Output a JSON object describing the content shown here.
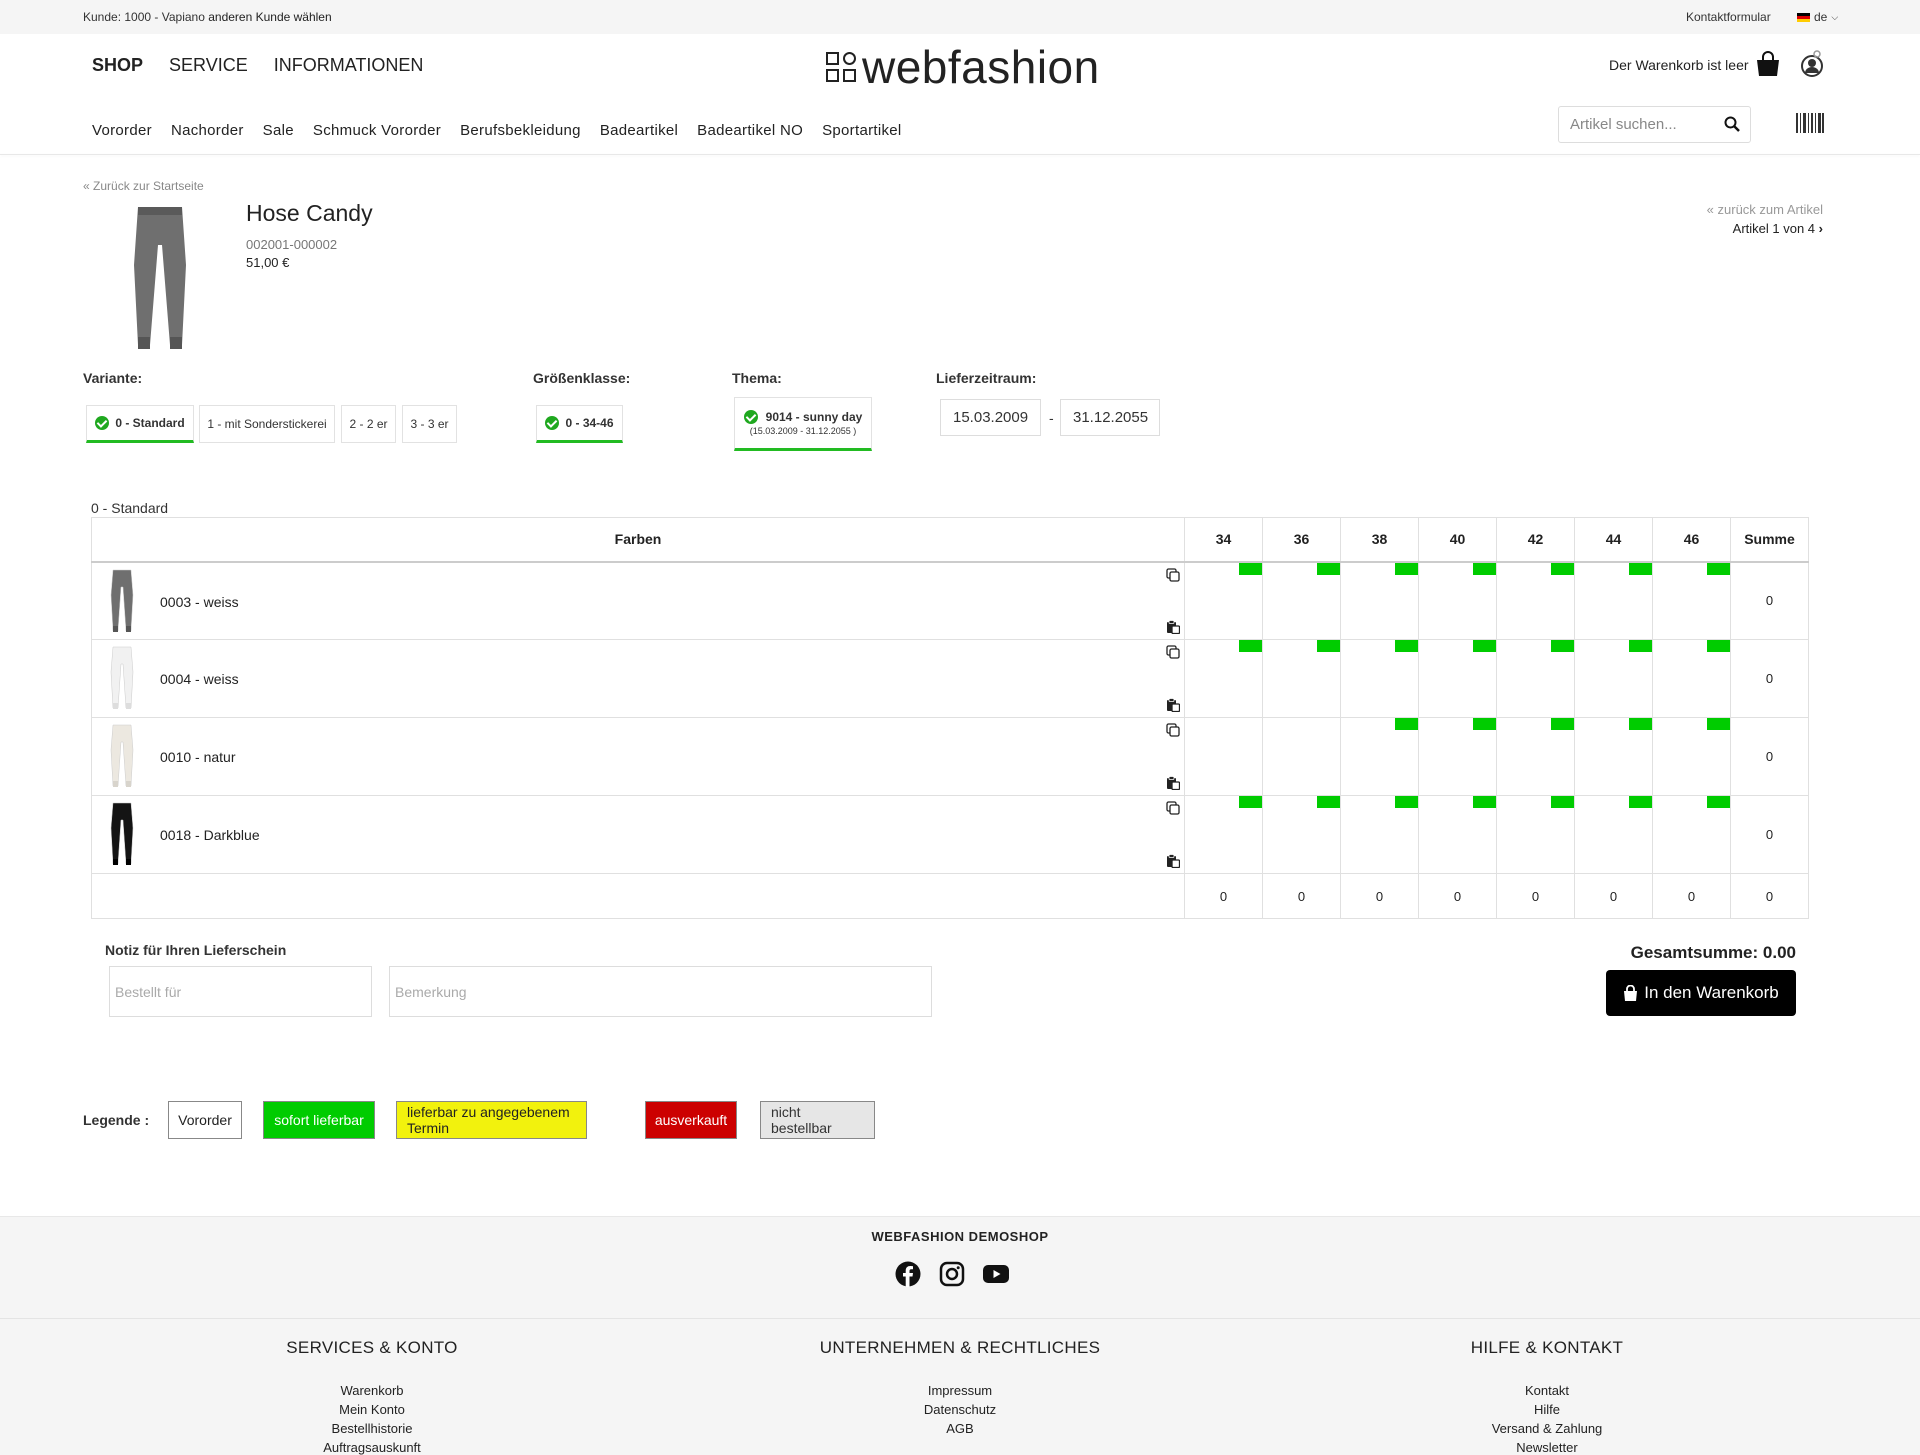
{
  "topbar": {
    "customer": "Kunde: 1000 - Vapiano",
    "change_customer": "anderen Kunde wählen",
    "contact": "Kontaktformular",
    "language": "de"
  },
  "header": {
    "main_nav": [
      "SHOP",
      "SERVICE",
      "INFORMATIONEN"
    ],
    "logo_text": "webfashion",
    "cart_text": "Der Warenkorb ist leer",
    "categories": [
      "Vororder",
      "Nachorder",
      "Sale",
      "Schmuck Vororder",
      "Berufsbekleidung",
      "Badeartikel",
      "Badeartikel NO",
      "Sportartikel"
    ],
    "search_placeholder": "Artikel suchen..."
  },
  "product": {
    "back_link": "Zurück zur Startseite",
    "title": "Hose Candy",
    "sku": "002001-000002",
    "price": "51,00 €",
    "back_to_articles": "zurück zum Artikel",
    "article_counter": "Artikel 1 von 4"
  },
  "selectors": {
    "variant_label": "Variante:",
    "variants": [
      "0 - Standard",
      "1 - mit Sonderstickerei",
      "2 - 2 er",
      "3 - 3 er"
    ],
    "size_class_label": "Größenklasse:",
    "size_class": "0 - 34-46",
    "theme_label": "Thema:",
    "theme_name": "9014 - sunny day",
    "theme_dates": "(15.03.2009 - 31.12.2055 )",
    "delivery_label": "Lieferzeitraum:",
    "delivery_from": "15.03.2009",
    "delivery_to": "31.12.2055"
  },
  "grid": {
    "caption": "0 - Standard",
    "color_header": "Farben",
    "sizes": [
      "34",
      "36",
      "38",
      "40",
      "42",
      "44",
      "46"
    ],
    "sum_header": "Summe",
    "rows": [
      {
        "label": "0003 - weiss",
        "available": [
          true,
          true,
          true,
          true,
          true,
          true,
          true
        ],
        "sum": "0"
      },
      {
        "label": "0004 - weiss",
        "available": [
          true,
          true,
          true,
          true,
          true,
          true,
          true
        ],
        "sum": "0"
      },
      {
        "label": "0010 - natur",
        "available": [
          false,
          false,
          true,
          true,
          true,
          true,
          true
        ],
        "sum": "0"
      },
      {
        "label": "0018 - Darkblue",
        "available": [
          true,
          true,
          true,
          true,
          true,
          true,
          true
        ],
        "sum": "0"
      }
    ],
    "totals": [
      "0",
      "0",
      "0",
      "0",
      "0",
      "0",
      "0",
      "0"
    ]
  },
  "notes": {
    "title": "Notiz für Ihren Lieferschein",
    "ordered_for_placeholder": "Bestellt für",
    "remark_placeholder": "Bemerkung"
  },
  "total": "Gesamtsumme: 0.00",
  "add_to_cart": "In den Warenkorb",
  "legend": {
    "label": "Legende :",
    "items": [
      {
        "text": "Vororder",
        "bg": "#ffffff",
        "fg": "#222222"
      },
      {
        "text": "sofort lieferbar",
        "bg": "#00cc00",
        "fg": "#ffffff"
      },
      {
        "text": "lieferbar zu angegebenem Termin",
        "bg": "#f2f20d",
        "fg": "#222222"
      },
      {
        "text": "ausverkauft",
        "bg": "#cc0000",
        "fg": "#ffffff"
      },
      {
        "text": "nicht bestellbar",
        "bg": "#e6e6e6",
        "fg": "#333333"
      }
    ]
  },
  "colors": {
    "available": "#00cc00",
    "active_underline": "#22bb22"
  },
  "footer": {
    "brand": "WEBFASHION DEMOSHOP",
    "socials": [
      "facebook-icon",
      "instagram-icon",
      "youtube-icon"
    ],
    "columns": [
      {
        "title": "SERVICES & KONTO",
        "links": [
          "Warenkorb",
          "Mein Konto",
          "Bestellhistorie",
          "Auftragsauskunft"
        ]
      },
      {
        "title": "UNTERNEHMEN & RECHTLICHES",
        "links": [
          "Impressum",
          "Datenschutz",
          "AGB"
        ]
      },
      {
        "title": "HILFE & KONTAKT",
        "links": [
          "Kontakt",
          "Hilfe",
          "Versand & Zahlung",
          "Newsletter"
        ]
      }
    ]
  }
}
